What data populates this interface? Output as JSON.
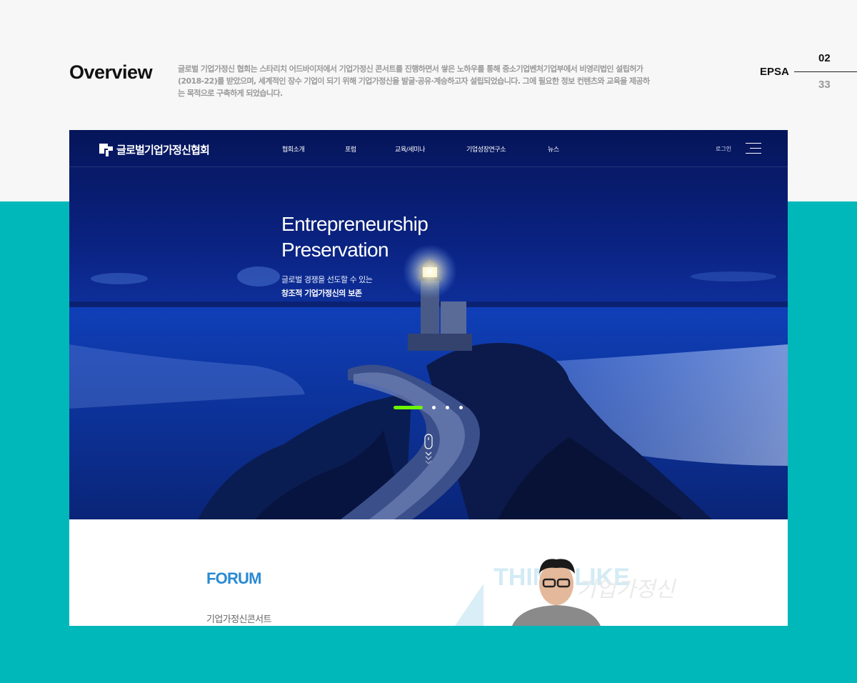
{
  "header": {
    "title": "Overview",
    "description": "글로벌 기업가정신 협회는 스타리치 어드바이저에서 기업가정신 콘서트를 진행하면서 쌓은 노하우를 통해 중소기업벤처기업부에서 비영리법인 설립허가(2018-22)를 받았으며, 세계적인 장수 기업이 되기 위해 기업가정신을 발굴·공유·계승하고자 설립되었습니다. 그에 필요한 정보 컨텐츠와 교육을 제공하는 목적으로 구축하게 되었습니다.",
    "project": "EPSA",
    "page_current": "02",
    "page_total": "33"
  },
  "site": {
    "logo_text": "글로벌기업가정신협회",
    "nav": [
      "협회소개",
      "포럼",
      "교육/세미나",
      "기업성장연구소",
      "뉴스"
    ],
    "login": "로그인",
    "hero": {
      "title_line1": "Entrepreneurship",
      "title_line2": "Preservation",
      "subtitle_line1": "글로벌 경쟁을 선도할 수 있는",
      "subtitle_line2": "창조적 기업가정신의 보존"
    },
    "slider": {
      "count": 4,
      "active_index": 0
    },
    "forum": {
      "title": "FORUM",
      "subtitle": "기업가정신콘서트",
      "art_text": "THINK LIKE",
      "art_calligraphy": "기업가정신"
    }
  },
  "colors": {
    "page_bg": "#f7f7f7",
    "teal": "#00b8b9",
    "hero_navy": "#0a2280",
    "slider_active": "#6cf400",
    "forum_blue": "#2a8ad2"
  }
}
